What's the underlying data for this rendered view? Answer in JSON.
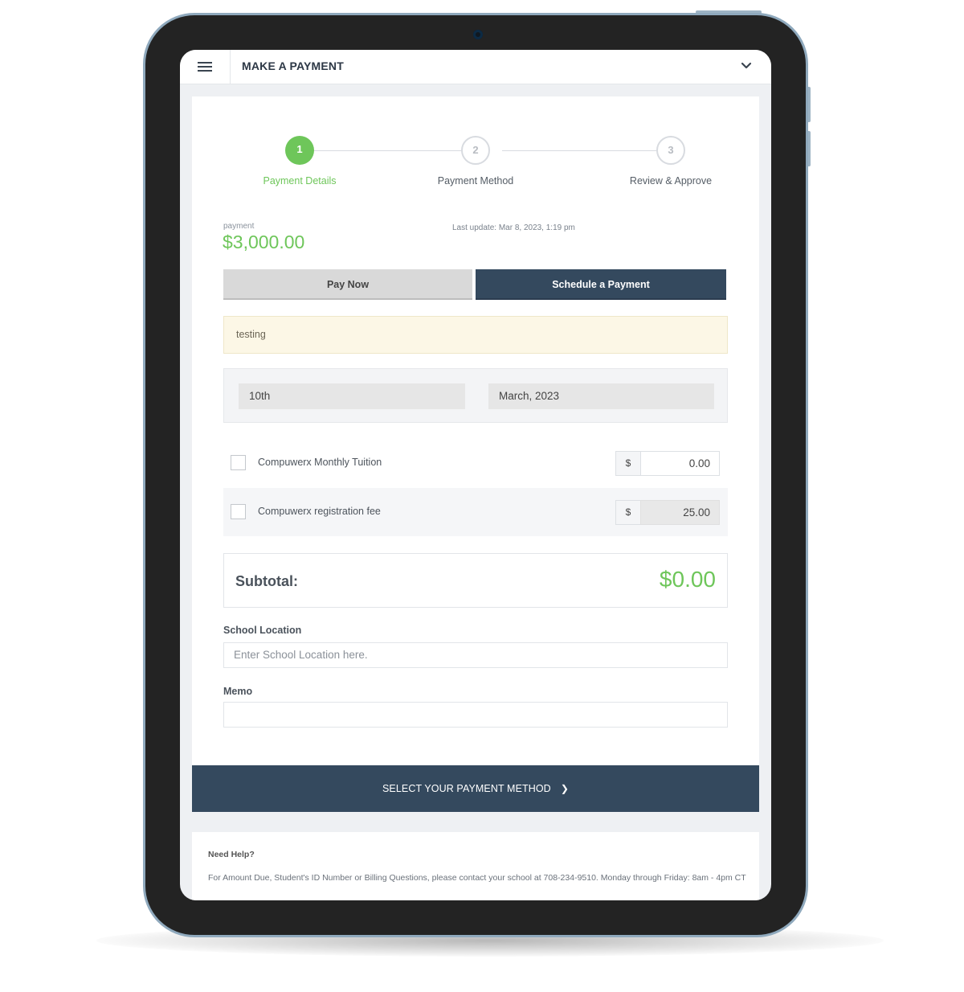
{
  "header": {
    "title": "MAKE A PAYMENT"
  },
  "steps": [
    {
      "number": "1",
      "label": "Payment Details",
      "state": "active"
    },
    {
      "number": "2",
      "label": "Payment Method",
      "state": "upcoming"
    },
    {
      "number": "3",
      "label": "Review & Approve",
      "state": "upcoming"
    }
  ],
  "payment": {
    "label": "payment",
    "amount": "$3,000.00",
    "last_update": "Last update: Mar 8, 2023, 1:19 pm"
  },
  "tabs": {
    "pay_now": "Pay Now",
    "schedule": "Schedule a Payment",
    "selected": "schedule"
  },
  "note": "testing",
  "schedule": {
    "day": "10th",
    "month": "March, 2023"
  },
  "items": [
    {
      "label": "Compuwerx Monthly Tuition",
      "currency": "$",
      "amount": "0.00",
      "checked": false
    },
    {
      "label": "Compuwerx registration fee",
      "currency": "$",
      "amount": "25.00",
      "checked": false
    }
  ],
  "subtotal": {
    "label": "Subtotal:",
    "value": "$0.00"
  },
  "school_location": {
    "label": "School Location",
    "placeholder": "Enter School Location here."
  },
  "memo": {
    "label": "Memo",
    "value": ""
  },
  "cta": {
    "label": "SELECT YOUR PAYMENT METHOD"
  },
  "help": {
    "title": "Need Help?",
    "text": "For Amount Due, Student's ID Number or Billing Questions, please contact your school at 708-234-9510.  Monday through Friday: 8am - 4pm CT"
  },
  "colors": {
    "accent_green": "#6ec65a",
    "navy": "#34495e",
    "note_bg": "#fcf7e6",
    "device_bezel": "#232323"
  },
  "icons": [
    "menu-icon",
    "chevron-down-icon",
    "chevron-right-icon",
    "camera-icon"
  ]
}
